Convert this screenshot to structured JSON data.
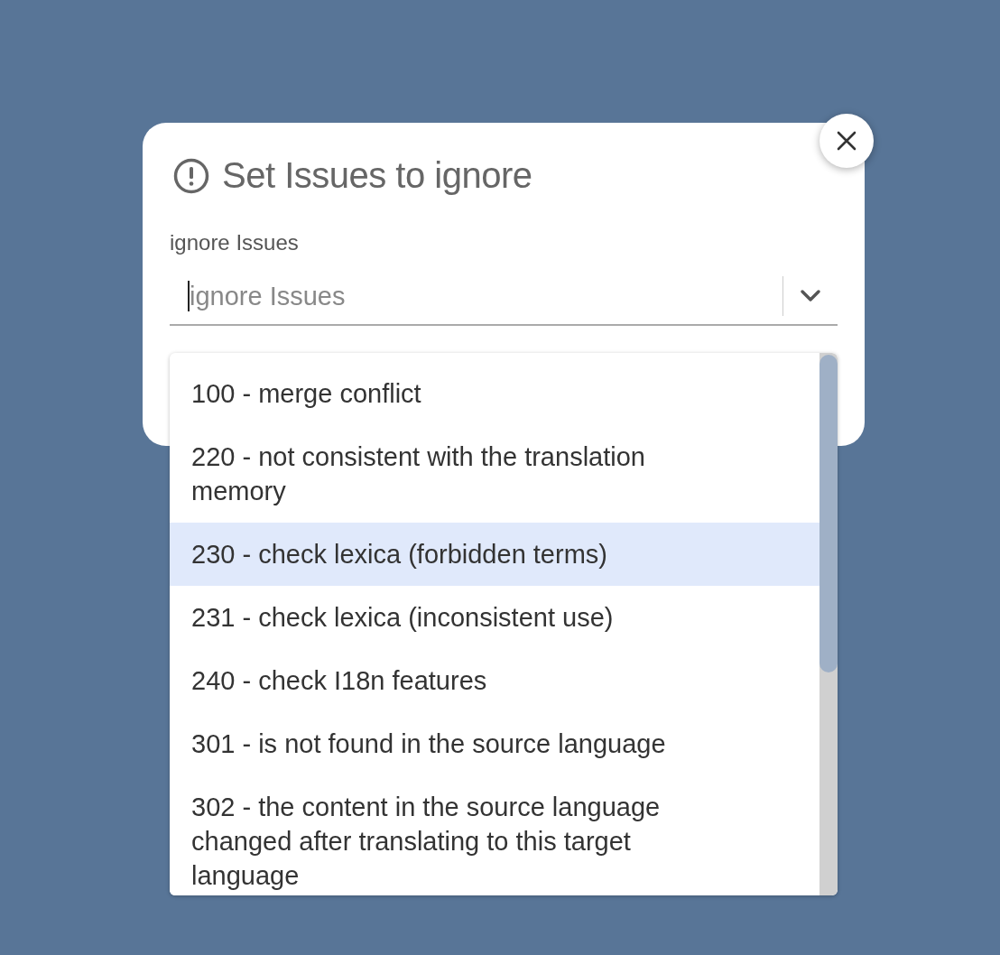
{
  "dialog": {
    "title": "Set Issues to ignore",
    "field": {
      "label": "ignore Issues",
      "placeholder": "ignore Issues",
      "focused": true,
      "expanded": true
    },
    "options": [
      {
        "label": "100 - merge conflict",
        "selected": false
      },
      {
        "label": "220 - not consistent with the translation memory",
        "selected": false
      },
      {
        "label": "230 - check lexica (forbidden terms)",
        "selected": true
      },
      {
        "label": "231 - check lexica (inconsistent use)",
        "selected": false
      },
      {
        "label": "240 - check I18n features",
        "selected": false
      },
      {
        "label": "301 - is not found in the source language",
        "selected": false
      },
      {
        "label": "302 - the content in the source language changed after translating to this target language",
        "selected": false
      }
    ]
  }
}
